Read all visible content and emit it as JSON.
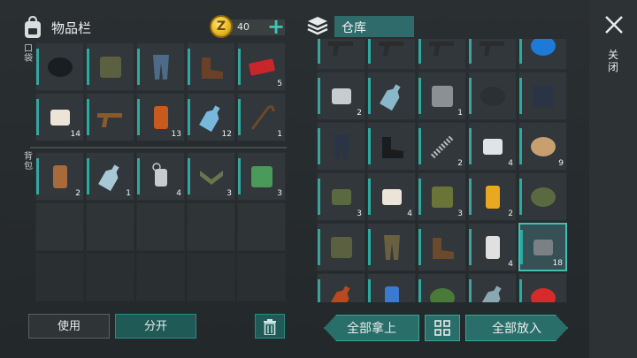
{
  "inventory": {
    "title": "物品栏",
    "coins": "40",
    "coin_symbol": "Z",
    "plus": "+",
    "pockets_label": "口袋",
    "backpack_label": "背包",
    "pocket_items": [
      {
        "icon": "beanie-icon",
        "qty": ""
      },
      {
        "icon": "jacket-icon",
        "qty": ""
      },
      {
        "icon": "pants-icon",
        "qty": ""
      },
      {
        "icon": "boots-icon",
        "qty": ""
      },
      {
        "icon": "coupon-icon",
        "qty": "5"
      },
      {
        "icon": "bandage-icon",
        "qty": "14"
      },
      {
        "icon": "shotgun-icon",
        "qty": ""
      },
      {
        "icon": "canned-food-icon",
        "qty": "13"
      },
      {
        "icon": "water-bottle-icon",
        "qty": "12"
      },
      {
        "icon": "scythe-icon",
        "qty": "1"
      }
    ],
    "backpack_items": [
      {
        "icon": "empty-can-icon",
        "qty": "2"
      },
      {
        "icon": "plastic-bottle-icon",
        "qty": "1"
      },
      {
        "icon": "dog-tag-icon",
        "qty": "4"
      },
      {
        "icon": "chevron-patch-icon",
        "qty": "3"
      },
      {
        "icon": "notepad-icon",
        "qty": "3"
      }
    ],
    "use_label": "使用",
    "split_label": "分开"
  },
  "warehouse": {
    "title": "仓库",
    "items": [
      {
        "icon": "pistol-icon",
        "qty": ""
      },
      {
        "icon": "pistol-icon",
        "qty": ""
      },
      {
        "icon": "smg-icon",
        "qty": ""
      },
      {
        "icon": "rifle-icon",
        "qty": ""
      },
      {
        "icon": "blue-blade-icon",
        "qty": ""
      },
      {
        "icon": "machine-part-icon",
        "qty": "2"
      },
      {
        "icon": "biohazard-roll-icon",
        "qty": ""
      },
      {
        "icon": "metal-plate-icon",
        "qty": "1"
      },
      {
        "icon": "helmet-icon",
        "qty": ""
      },
      {
        "icon": "tactical-vest-icon",
        "qty": ""
      },
      {
        "icon": "tactical-pants-icon",
        "qty": ""
      },
      {
        "icon": "tactical-boots-icon",
        "qty": ""
      },
      {
        "icon": "spring-icon",
        "qty": "2"
      },
      {
        "icon": "silver-bars-icon",
        "qty": "4"
      },
      {
        "icon": "wire-spool-icon",
        "qty": "9"
      },
      {
        "icon": "medkit-bag-icon",
        "qty": "3"
      },
      {
        "icon": "bandage-icon",
        "qty": "4"
      },
      {
        "icon": "jerrycan-icon",
        "qty": "3"
      },
      {
        "icon": "battery-icon",
        "qty": "2"
      },
      {
        "icon": "military-cap-icon",
        "qty": ""
      },
      {
        "icon": "military-jacket-icon",
        "qty": ""
      },
      {
        "icon": "military-pants-icon",
        "qty": ""
      },
      {
        "icon": "work-boots-icon",
        "qty": ""
      },
      {
        "icon": "spray-can-icon",
        "qty": "4"
      },
      {
        "icon": "steel-ingot-icon",
        "qty": "18"
      },
      {
        "icon": "potion-bottle-icon",
        "qty": ""
      },
      {
        "icon": "spray-can-blue-icon",
        "qty": ""
      },
      {
        "icon": "grenade-icon",
        "qty": ""
      },
      {
        "icon": "glass-jar-icon",
        "qty": ""
      },
      {
        "icon": "bottle-cap-icon",
        "qty": ""
      }
    ],
    "take_all_label": "全部拿上",
    "put_all_label": "全部放入"
  },
  "close_label": "关闭",
  "colors": {
    "accent": "#2fa9a0",
    "button": "#1f5a56",
    "gold": "#e9b923"
  }
}
